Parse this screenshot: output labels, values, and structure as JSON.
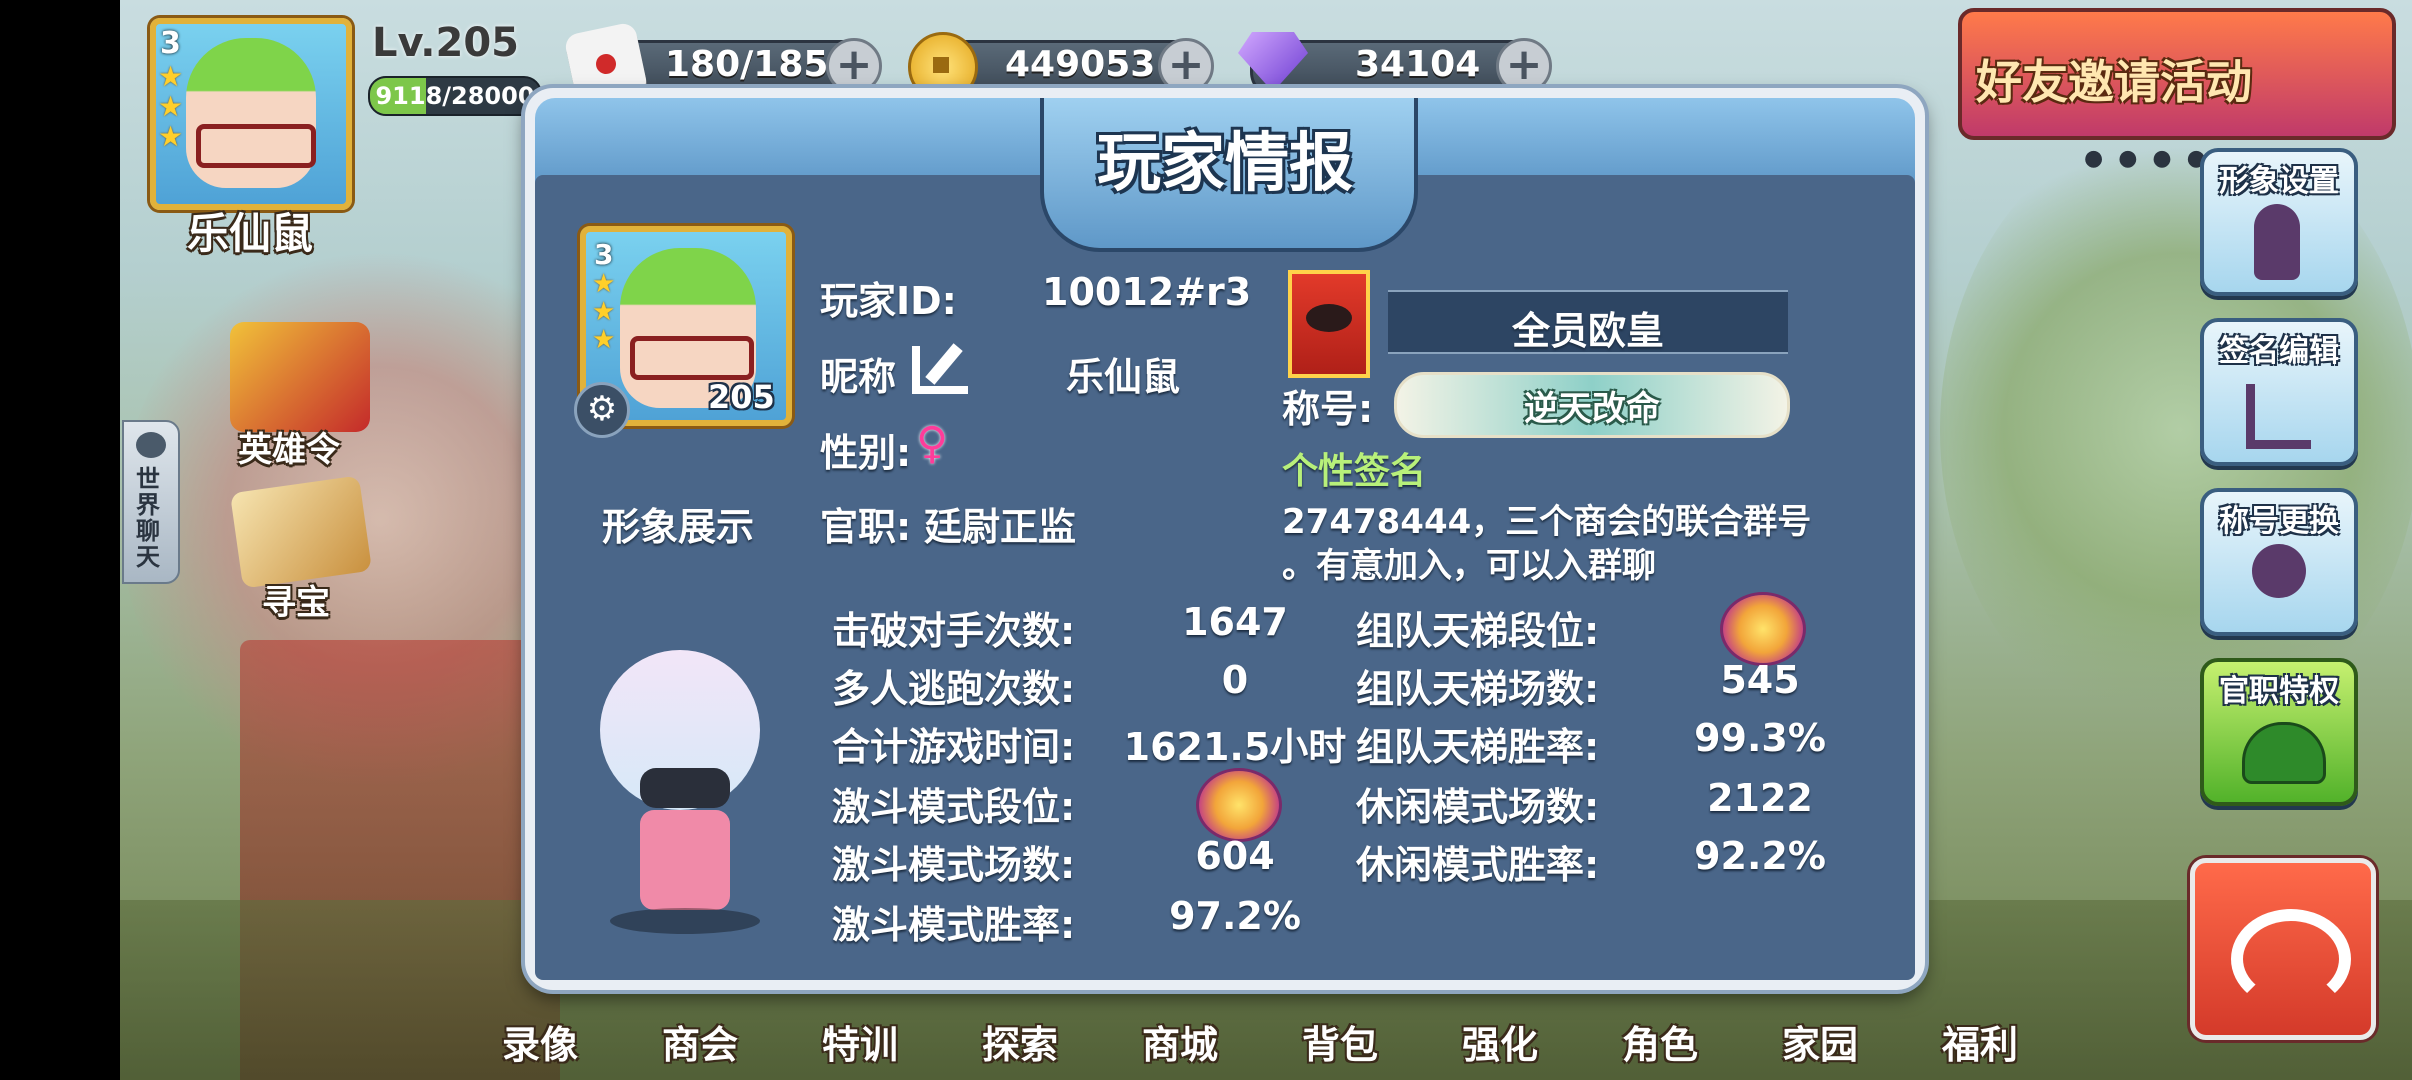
{
  "player_top": {
    "level": "Lv.205",
    "exp": "9118/28000",
    "name": "乐仙鼠",
    "stars": 3
  },
  "resources": [
    {
      "icon": "dice-icon",
      "value": "180/185"
    },
    {
      "icon": "gold-coin-icon",
      "value": "449053"
    },
    {
      "icon": "diamond-icon",
      "value": "34104"
    }
  ],
  "event_banner": "好友邀请活动",
  "left_menu": {
    "hero_token": "英雄令",
    "treasure": "寻宝",
    "world_chat": "世界聊天"
  },
  "side_buttons": [
    "形象设置",
    "签名编辑",
    "称号更换",
    "官职特权"
  ],
  "bottom_nav": [
    "录像",
    "商会",
    "特训",
    "探索",
    "商城",
    "背包",
    "强化",
    "角色",
    "家园",
    "福利"
  ],
  "modal": {
    "title": "玩家情报",
    "avatar_level": "205",
    "avatar_stars": 3,
    "show_label": "形象展示",
    "id_label": "玩家ID:",
    "id_value": "10012#r3",
    "nickname_label": "昵称",
    "nickname_value": "乐仙鼠",
    "gender_label": "性别:",
    "gender_symbol": "♀",
    "office_label": "官职:",
    "office_value": "廷尉正监",
    "guild_name": "全员欧皇",
    "title_label": "称号:",
    "title_badge": "逆天改命",
    "signature_label": "个性签名",
    "signature_lines": [
      "27478444，三个商会的联合群号",
      "。有意加入，可以入群聊"
    ],
    "stats_left": [
      {
        "label": "击破对手次数:",
        "value": "1647"
      },
      {
        "label": "多人逃跑次数:",
        "value": "0"
      },
      {
        "label": "合计游戏时间:",
        "value": "1621.5小时"
      },
      {
        "label": "激斗模式段位:",
        "value": ""
      },
      {
        "label": "激斗模式场数:",
        "value": "604"
      },
      {
        "label": "激斗模式胜率:",
        "value": "97.2%"
      }
    ],
    "stats_right": [
      {
        "label": "组队天梯段位:",
        "value": ""
      },
      {
        "label": "组队天梯场数:",
        "value": "545"
      },
      {
        "label": "组队天梯胜率:",
        "value": "99.3%"
      },
      {
        "label": "休闲模式场数:",
        "value": "2122"
      },
      {
        "label": "休闲模式胜率:",
        "value": "92.2%"
      }
    ]
  },
  "colors": {
    "gender": "#ff3c9a",
    "signature_label": "#b8f07a",
    "modal_body": "#4a6689",
    "return_button": "#e0523a"
  }
}
